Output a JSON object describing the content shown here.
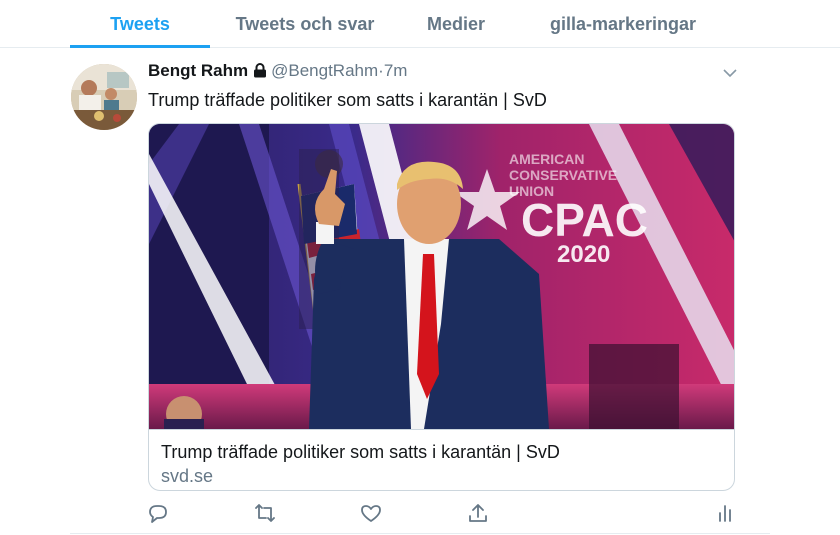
{
  "tabs": [
    {
      "label": "Tweets",
      "active": true
    },
    {
      "label": "Tweets och svar",
      "active": false
    },
    {
      "label": "Medier",
      "active": false
    },
    {
      "label": "gilla-markeringar",
      "active": false
    }
  ],
  "tweet": {
    "author_name": "Bengt Rahm",
    "handle": "@BengtRahm",
    "separator": "·",
    "time": "7m",
    "text": "Trump träffade politiker som satts i karantän | SvD",
    "protected_icon": "lock-icon",
    "card": {
      "title": "Trump träffade politiker som satts i karantän | SvD",
      "domain": "svd.se",
      "image_sign_lines": [
        "AMERICAN",
        "CONSERVATIVE",
        "UNION"
      ],
      "image_logo": "CPAC",
      "image_year": "2020"
    },
    "actions": [
      "reply-icon",
      "retweet-icon",
      "like-icon",
      "share-icon",
      "analytics-icon"
    ]
  },
  "colors": {
    "accent": "#1da1f2",
    "secondary_text": "#657786",
    "border": "#ccd6dd"
  }
}
